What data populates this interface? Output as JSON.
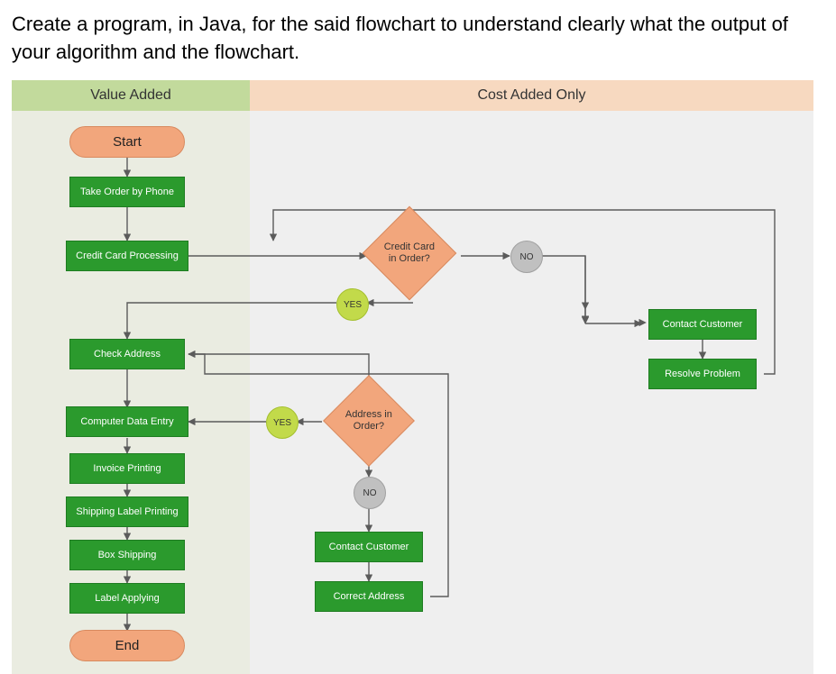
{
  "question_text": "Create a program, in Java, for the said flowchart to understand clearly what the output of your algorithm and the flowchart.",
  "swimlanes": {
    "left_title": "Value Added",
    "right_title": "Cost Added Only"
  },
  "nodes": {
    "start": "Start",
    "take_order": "Take Order by Phone",
    "cc_processing": "Credit Card Processing",
    "check_address": "Check Address",
    "data_entry": "Computer Data Entry",
    "invoice_printing": "Invoice Printing",
    "label_printing": "Shipping Label Printing",
    "box_shipping": "Box Shipping",
    "label_applying": "Label Applying",
    "end": "End",
    "cc_in_order": "Credit Card in Order?",
    "addr_in_order": "Address in Order?",
    "contact_customer": "Contact Customer",
    "resolve_problem": "Resolve Problem",
    "contact_customer2": "Contact Customer",
    "correct_address": "Correct Address"
  },
  "labels": {
    "yes": "YES",
    "no": "NO"
  }
}
